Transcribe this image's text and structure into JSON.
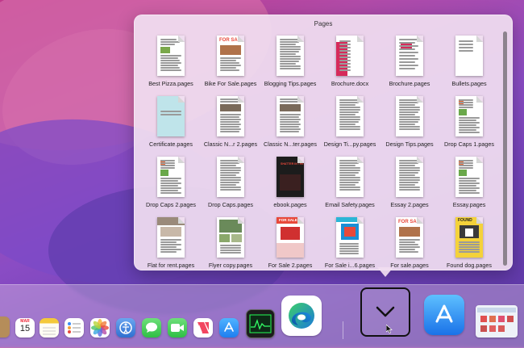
{
  "popover": {
    "title": "Pages",
    "files": [
      {
        "name": "Best Pizza.pages",
        "thumb": "pizza"
      },
      {
        "name": "Bike For Sale.pages",
        "thumb": "forsale"
      },
      {
        "name": "Blogging Tips.pages",
        "thumb": "text"
      },
      {
        "name": "Brochure.docx",
        "thumb": "brochure"
      },
      {
        "name": "Brochure.pages",
        "thumb": "brochure2"
      },
      {
        "name": "Bullets.pages",
        "thumb": "plain"
      },
      {
        "name": "Certificate.pages",
        "thumb": "certificate"
      },
      {
        "name": "Classic N...r 2.pages",
        "thumb": "classic"
      },
      {
        "name": "Classic N...ter.pages",
        "thumb": "classic"
      },
      {
        "name": "Design Ti...py.pages",
        "thumb": "text"
      },
      {
        "name": "Design Tips.pages",
        "thumb": "text"
      },
      {
        "name": "Drop Caps 1.pages",
        "thumb": "dropcaps"
      },
      {
        "name": "Drop Caps 2.pages",
        "thumb": "dropcaps"
      },
      {
        "name": "Drop Caps.pages",
        "thumb": "text"
      },
      {
        "name": "ebook.pages",
        "thumb": "ebook"
      },
      {
        "name": "Email Safety.pages",
        "thumb": "text"
      },
      {
        "name": "Essay 2.pages",
        "thumb": "text"
      },
      {
        "name": "Essay.pages",
        "thumb": "dropcaps"
      },
      {
        "name": "Flat for rent.pages",
        "thumb": "flat"
      },
      {
        "name": "Flyer copy.pages",
        "thumb": "flyer"
      },
      {
        "name": "For Sale 2.pages",
        "thumb": "forsale2"
      },
      {
        "name": "For Sale i...6.pages",
        "thumb": "forsale3"
      },
      {
        "name": "For sale.pages",
        "thumb": "forsale"
      },
      {
        "name": "Found dog.pages",
        "thumb": "dog"
      }
    ],
    "thumb_text": {
      "forsale": "FOR SA",
      "ebook": "SHATTER IN THE DARK",
      "forsale2": "FOR SALE",
      "dog": "FOUND"
    }
  },
  "dock": {
    "calendar_month": "MAR",
    "calendar_day": "15",
    "icons": [
      "calendar-icon",
      "notes-icon",
      "reminders-icon",
      "photos-icon",
      "system-preferences-icon",
      "messages-icon",
      "facetime-icon",
      "news-icon",
      "app-store-icon",
      "activity-monitor-icon",
      "edge-icon",
      "stack-toggle-icon",
      "app-store-large-icon",
      "finder-window-icon"
    ]
  },
  "colors": {
    "accent_red": "#e8483a",
    "edge_blue": "#1b7ad8",
    "appstore_blue": "#1e8cf5"
  }
}
